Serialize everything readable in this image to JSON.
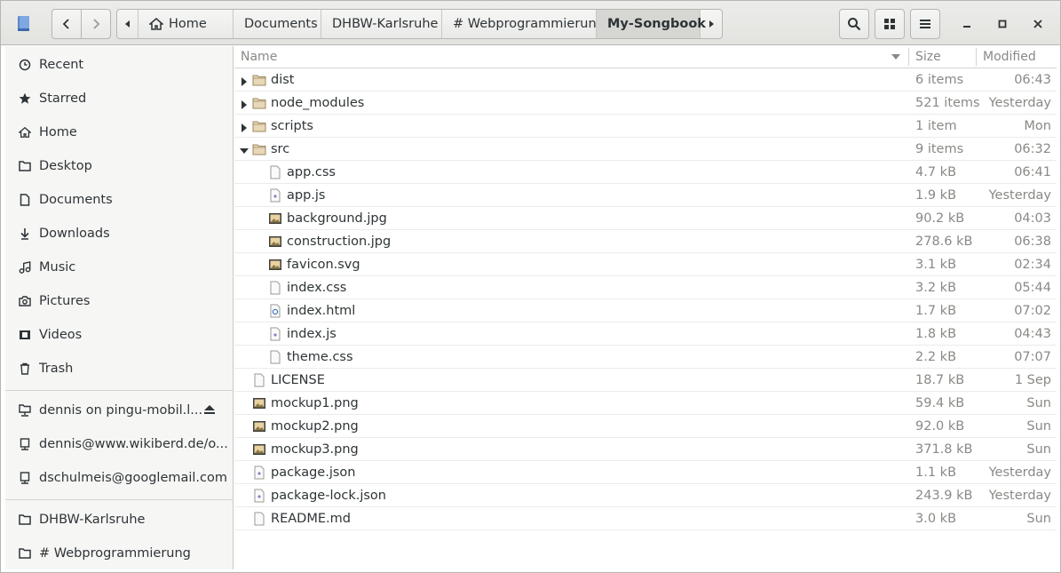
{
  "header": {
    "breadcrumbs": [
      {
        "label": "Home"
      },
      {
        "label": "Documents"
      },
      {
        "label": "DHBW-Karlsruhe"
      },
      {
        "label": "# Webprogrammierung"
      },
      {
        "label": "My-Songbook"
      }
    ]
  },
  "sidebar": {
    "places": [
      {
        "label": "Recent",
        "icon": "clock-icon"
      },
      {
        "label": "Starred",
        "icon": "star-icon"
      },
      {
        "label": "Home",
        "icon": "home-icon"
      },
      {
        "label": "Desktop",
        "icon": "folder-icon"
      },
      {
        "label": "Documents",
        "icon": "document-icon"
      },
      {
        "label": "Downloads",
        "icon": "download-icon"
      },
      {
        "label": "Music",
        "icon": "music-icon"
      },
      {
        "label": "Pictures",
        "icon": "camera-icon"
      },
      {
        "label": "Videos",
        "icon": "video-icon"
      },
      {
        "label": "Trash",
        "icon": "trash-icon"
      }
    ],
    "network": [
      {
        "label": "dennis on pingu-mobil.l...",
        "icon": "network-folder-icon"
      },
      {
        "label": "dennis@www.wikiberd.de/o...",
        "icon": "network-drive-icon"
      },
      {
        "label": "dschulmeis@googlemail.com",
        "icon": "network-drive-icon"
      }
    ],
    "bookmarks": [
      {
        "label": "DHBW-Karlsruhe",
        "icon": "folder-icon"
      },
      {
        "label": "# Webprogrammierung",
        "icon": "folder-icon"
      }
    ]
  },
  "list": {
    "columns": {
      "name": "Name",
      "size": "Size",
      "modified": "Modified"
    },
    "rows": [
      {
        "name": "dist",
        "size": "6 items",
        "modified": "06:43",
        "type": "folder",
        "indent": 0,
        "expander": "collapsed"
      },
      {
        "name": "node_modules",
        "size": "521 items",
        "modified": "Yesterday",
        "type": "folder",
        "indent": 0,
        "expander": "collapsed"
      },
      {
        "name": "scripts",
        "size": "1 item",
        "modified": "Mon",
        "type": "folder",
        "indent": 0,
        "expander": "collapsed"
      },
      {
        "name": "src",
        "size": "9 items",
        "modified": "06:32",
        "type": "folder",
        "indent": 0,
        "expander": "expanded"
      },
      {
        "name": "app.css",
        "size": "4.7 kB",
        "modified": "06:41",
        "type": "text",
        "indent": 1
      },
      {
        "name": "app.js",
        "size": "1.9 kB",
        "modified": "Yesterday",
        "type": "script",
        "indent": 1
      },
      {
        "name": "background.jpg",
        "size": "90.2 kB",
        "modified": "04:03",
        "type": "image",
        "indent": 1
      },
      {
        "name": "construction.jpg",
        "size": "278.6 kB",
        "modified": "06:38",
        "type": "image",
        "indent": 1
      },
      {
        "name": "favicon.svg",
        "size": "3.1 kB",
        "modified": "02:34",
        "type": "image",
        "indent": 1
      },
      {
        "name": "index.css",
        "size": "3.2 kB",
        "modified": "05:44",
        "type": "text",
        "indent": 1
      },
      {
        "name": "index.html",
        "size": "1.7 kB",
        "modified": "07:02",
        "type": "html",
        "indent": 1
      },
      {
        "name": "index.js",
        "size": "1.8 kB",
        "modified": "04:43",
        "type": "script",
        "indent": 1
      },
      {
        "name": "theme.css",
        "size": "2.2 kB",
        "modified": "07:07",
        "type": "text",
        "indent": 1
      },
      {
        "name": "LICENSE",
        "size": "18.7 kB",
        "modified": "1 Sep",
        "type": "text",
        "indent": 0
      },
      {
        "name": "mockup1.png",
        "size": "59.4 kB",
        "modified": "Sun",
        "type": "image",
        "indent": 0
      },
      {
        "name": "mockup2.png",
        "size": "92.0 kB",
        "modified": "Sun",
        "type": "image",
        "indent": 0
      },
      {
        "name": "mockup3.png",
        "size": "371.8 kB",
        "modified": "Sun",
        "type": "image",
        "indent": 0
      },
      {
        "name": "package.json",
        "size": "1.1 kB",
        "modified": "Yesterday",
        "type": "script",
        "indent": 0
      },
      {
        "name": "package-lock.json",
        "size": "243.9 kB",
        "modified": "Yesterday",
        "type": "script",
        "indent": 0
      },
      {
        "name": "README.md",
        "size": "3.0 kB",
        "modified": "Sun",
        "type": "text",
        "indent": 0
      }
    ]
  }
}
